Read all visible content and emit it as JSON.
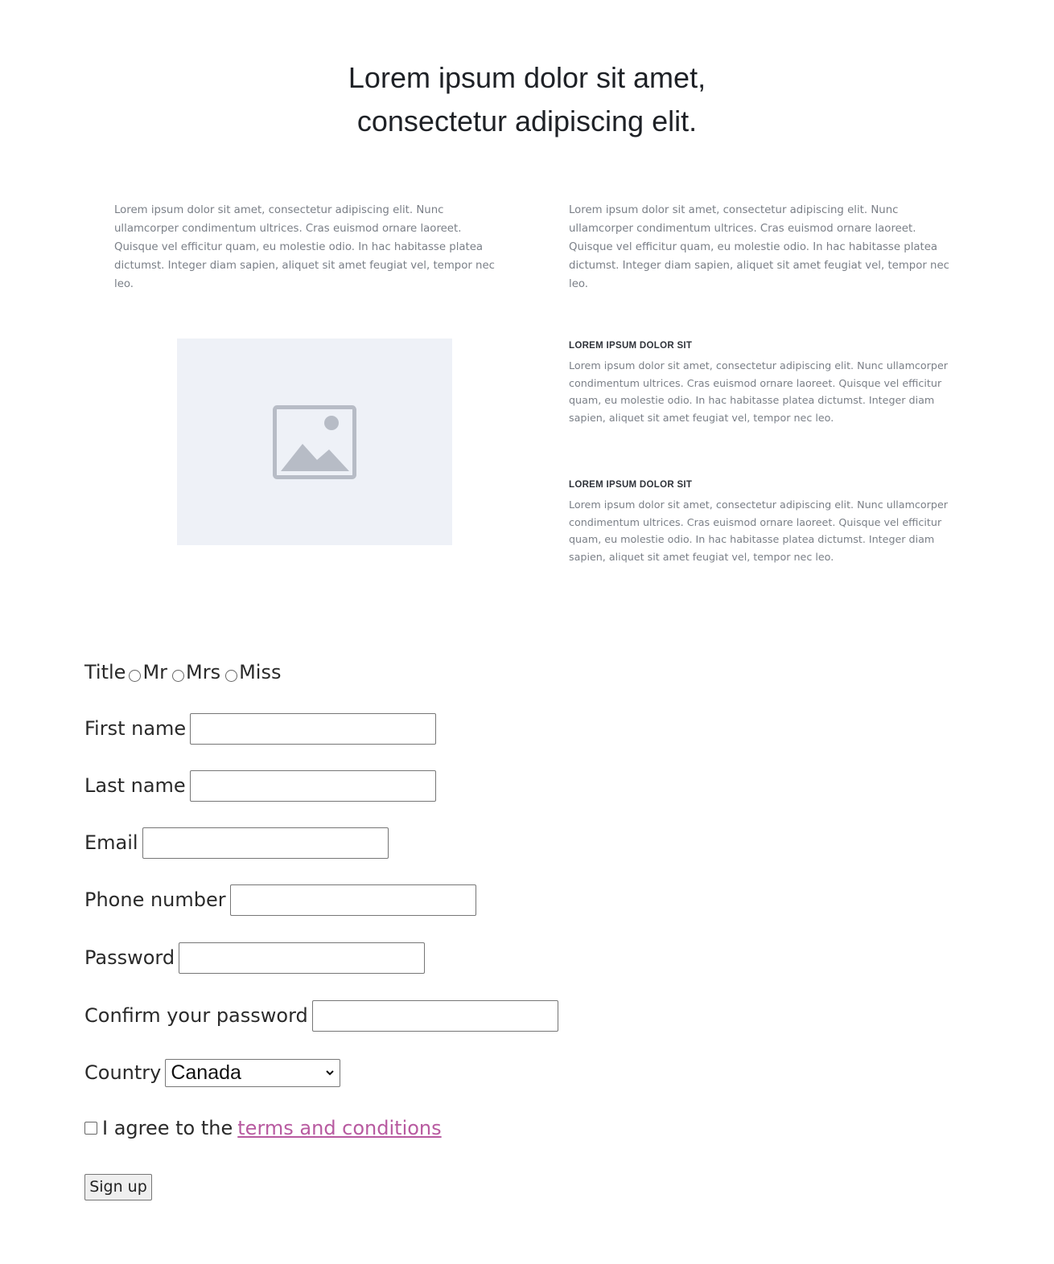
{
  "hero": {
    "title_line1": "Lorem ipsum dolor sit amet,",
    "title_line2": "consectetur adipiscing elit."
  },
  "intro": {
    "left_paragraph": "Lorem ipsum dolor sit amet, consectetur adipiscing elit. Nunc ullamcorper condimentum ultrices. Cras euismod ornare laoreet. Quisque vel efficitur quam, eu molestie odio. In hac habitasse platea dictumst. Integer diam sapien, aliquet sit amet feugiat vel, tempor nec leo.",
    "right_paragraph": "Lorem ipsum dolor sit amet, consectetur adipiscing elit. Nunc ullamcorper condimentum ultrices. Cras euismod ornare laoreet. Quisque vel efficitur quam, eu molestie odio. In hac habitasse platea dictumst. Integer diam sapien, aliquet sit amet feugiat vel, tempor nec leo."
  },
  "media": {
    "image_icon": "image-placeholder-icon"
  },
  "features": [
    {
      "heading": "LOREM IPSUM DOLOR SIT",
      "text": "Lorem ipsum dolor sit amet, consectetur adipiscing elit. Nunc ullamcorper condimentum ultrices. Cras euismod ornare laoreet. Quisque vel efficitur quam, eu molestie odio. In hac habitasse platea dictumst. Integer diam sapien, aliquet sit amet feugiat vel, tempor nec leo."
    },
    {
      "heading": "LOREM IPSUM DOLOR SIT",
      "text": "Lorem ipsum dolor sit amet, consectetur adipiscing elit. Nunc ullamcorper condimentum ultrices. Cras euismod ornare laoreet. Quisque vel efficitur quam, eu molestie odio. In hac habitasse platea dictumst. Integer diam sapien, aliquet sit amet feugiat vel, tempor nec leo."
    }
  ],
  "form": {
    "title_label": "Title",
    "title_options": [
      "Mr",
      "Mrs",
      "Miss"
    ],
    "first_name_label": "First name",
    "first_name_value": "",
    "last_name_label": "Last name",
    "last_name_value": "",
    "email_label": "Email",
    "email_value": "",
    "phone_label": "Phone number",
    "phone_value": "",
    "password_label": "Password",
    "password_value": "",
    "confirm_password_label": "Confirm your password",
    "confirm_password_value": "",
    "country_label": "Country",
    "country_selected": "Canada",
    "agree_prefix": "I agree to the",
    "terms_link": "terms and conditions",
    "signup_label": "Sign up"
  },
  "colors": {
    "link": "#b85aa0",
    "placeholder_bg": "#eef1f7",
    "placeholder_icon": "#b7bcc6",
    "body_text": "#7a7f87"
  }
}
